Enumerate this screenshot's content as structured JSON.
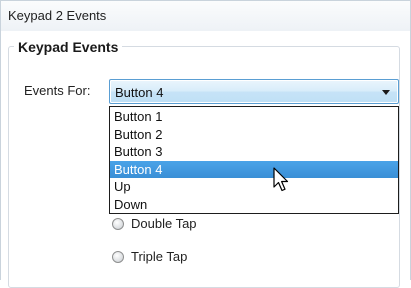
{
  "window": {
    "title": "Keypad 2 Events"
  },
  "group": {
    "title": "Keypad Events"
  },
  "events_for": {
    "label": "Events For:",
    "selected": "Button 4",
    "options": [
      "Button 1",
      "Button 2",
      "Button 3",
      "Button 4",
      "Up",
      "Down"
    ]
  },
  "radios": [
    {
      "label": "Double Tap",
      "checked": false
    },
    {
      "label": "Triple Tap",
      "checked": false
    }
  ],
  "colors": {
    "highlight": "#3a8fd6",
    "combo_border": "#5a9ed3"
  },
  "icons": {
    "cursor": "mouse-pointer-icon",
    "dropdown": "chevron-down-icon"
  }
}
